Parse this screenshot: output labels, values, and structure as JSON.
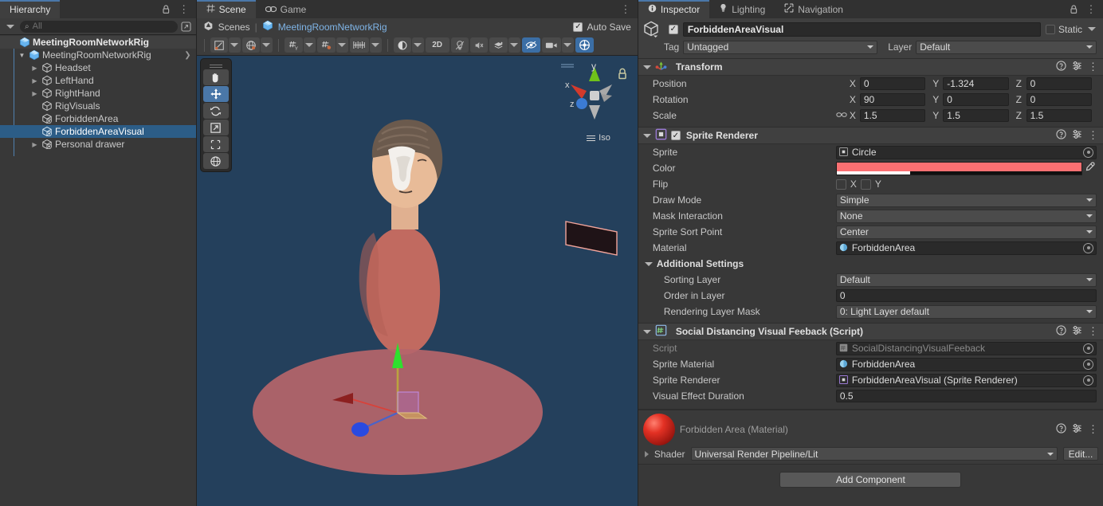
{
  "hierarchy": {
    "tab_label": "Hierarchy",
    "search_placeholder": "All",
    "root_label": "MeetingRoomNetworkRig",
    "items": [
      {
        "label": "MeetingRoomNetworkRig",
        "depth": 1,
        "expanded": true,
        "selected": false,
        "prefab": true
      },
      {
        "label": "Headset",
        "depth": 2,
        "expanded": false,
        "selected": false,
        "prefab": true
      },
      {
        "label": "LeftHand",
        "depth": 2,
        "expanded": false,
        "selected": false,
        "prefab": true
      },
      {
        "label": "RightHand",
        "depth": 2,
        "expanded": false,
        "selected": false,
        "prefab": true
      },
      {
        "label": "RigVisuals",
        "depth": 2,
        "expanded": null,
        "selected": false,
        "prefab": true
      },
      {
        "label": "ForbiddenArea",
        "depth": 2,
        "expanded": null,
        "selected": false,
        "prefab": false
      },
      {
        "label": "ForbiddenAreaVisual",
        "depth": 2,
        "expanded": null,
        "selected": true,
        "prefab": false
      },
      {
        "label": "Personal drawer",
        "depth": 2,
        "expanded": false,
        "selected": false,
        "prefab": false
      }
    ]
  },
  "scene": {
    "tabs": [
      {
        "label": "Scene",
        "active": true
      },
      {
        "label": "Game",
        "active": false
      }
    ],
    "breadcrumb_scenes": "Scenes",
    "breadcrumb_sep": "|",
    "breadcrumb_scene_name": "MeetingRoomNetworkRig",
    "auto_save_label": "Auto Save",
    "auto_save_checked": true,
    "toolbar": {
      "buttons_2d_label": "2D",
      "items": [
        "pivot-center-icon",
        "handle-global-icon",
        "grid-snap-icon",
        "grid-visibility-icon",
        "scene-layers-icon",
        "lighting-icon",
        "audio-icon",
        "effects-icon",
        "hidden-objects-icon",
        "camera-icon",
        "gizmos-icon"
      ]
    },
    "tool_palette": [
      {
        "name": "hand-tool",
        "active": false
      },
      {
        "name": "move-tool",
        "active": true
      },
      {
        "name": "rotate-tool",
        "active": false
      },
      {
        "name": "scale-tool",
        "active": false
      },
      {
        "name": "rect-tool",
        "active": false
      },
      {
        "name": "transform-tool",
        "active": false
      }
    ],
    "gizmo": {
      "x_label": "x",
      "y_label": "y",
      "z_label": "z",
      "projection_label": "Iso",
      "x_color": "#d33a2c",
      "y_color": "#6fc21a",
      "z_color": "#3b7bd4"
    },
    "background_color": "#24405c",
    "forbidden_area_color": "#b56366"
  },
  "inspector": {
    "tabs": [
      {
        "label": "Inspector",
        "icon": "info-icon",
        "active": true
      },
      {
        "label": "Lighting",
        "icon": "bulb-icon",
        "active": false
      },
      {
        "label": "Navigation",
        "icon": "navigation-icon",
        "active": false
      }
    ],
    "game_object": {
      "enabled": true,
      "name": "ForbiddenAreaVisual",
      "static_label": "Static",
      "static_checked": false,
      "tag_label": "Tag",
      "tag_value": "Untagged",
      "layer_label": "Layer",
      "layer_value": "Default"
    },
    "components": [
      {
        "name": "Transform",
        "icon": "transform-icon",
        "has_checkbox": false,
        "rows": [
          {
            "type": "vector3",
            "label": "Position",
            "link": false,
            "x": "0",
            "y": "-1.324",
            "z": "0"
          },
          {
            "type": "vector3",
            "label": "Rotation",
            "link": false,
            "x": "90",
            "y": "0",
            "z": "0"
          },
          {
            "type": "vector3",
            "label": "Scale",
            "link": true,
            "x": "1.5",
            "y": "1.5",
            "z": "1.5"
          }
        ]
      },
      {
        "name": "Sprite Renderer",
        "icon": "sprite-renderer-icon",
        "has_checkbox": true,
        "checked": true,
        "rows": [
          {
            "type": "object",
            "label": "Sprite",
            "value": "Circle",
            "icon": "sprite-asset-icon"
          },
          {
            "type": "color",
            "label": "Color",
            "color": "#fb7072",
            "alpha_pct": 30
          },
          {
            "type": "flip",
            "label": "Flip",
            "x_label": "X",
            "y_label": "Y",
            "x_checked": false,
            "y_checked": false
          },
          {
            "type": "dropdown",
            "label": "Draw Mode",
            "value": "Simple"
          },
          {
            "type": "dropdown",
            "label": "Mask Interaction",
            "value": "None"
          },
          {
            "type": "dropdown",
            "label": "Sprite Sort Point",
            "value": "Center"
          },
          {
            "type": "object",
            "label": "Material",
            "value": "ForbiddenArea",
            "icon": "material-asset-icon"
          },
          {
            "type": "subheader",
            "label": "Additional Settings"
          },
          {
            "type": "dropdown",
            "label": "Sorting Layer",
            "value": "Default",
            "indent": true
          },
          {
            "type": "text",
            "label": "Order in Layer",
            "value": "0",
            "indent": true
          },
          {
            "type": "dropdown",
            "label": "Rendering Layer Mask",
            "value": "0: Light Layer default",
            "indent": true
          }
        ]
      },
      {
        "name": "Social Distancing Visual Feeback (Script)",
        "icon": "script-icon",
        "has_checkbox": false,
        "rows": [
          {
            "type": "object",
            "label": "Script",
            "value": "SocialDistancingVisualFeeback",
            "icon": "script-asset-icon",
            "disabled": true
          },
          {
            "type": "object",
            "label": "Sprite Material",
            "value": "ForbiddenArea",
            "icon": "material-asset-icon"
          },
          {
            "type": "object",
            "label": "Sprite Renderer",
            "value": "ForbiddenAreaVisual (Sprite Renderer)",
            "icon": "sprite-renderer-asset-icon"
          },
          {
            "type": "text",
            "label": "Visual Effect Duration",
            "value": "0.5"
          }
        ]
      }
    ],
    "material_preview": {
      "title": "Forbidden Area (Material)",
      "shader_label": "Shader",
      "shader_value": "Universal Render Pipeline/Lit",
      "edit_label": "Edit..."
    },
    "add_component_label": "Add Component"
  }
}
